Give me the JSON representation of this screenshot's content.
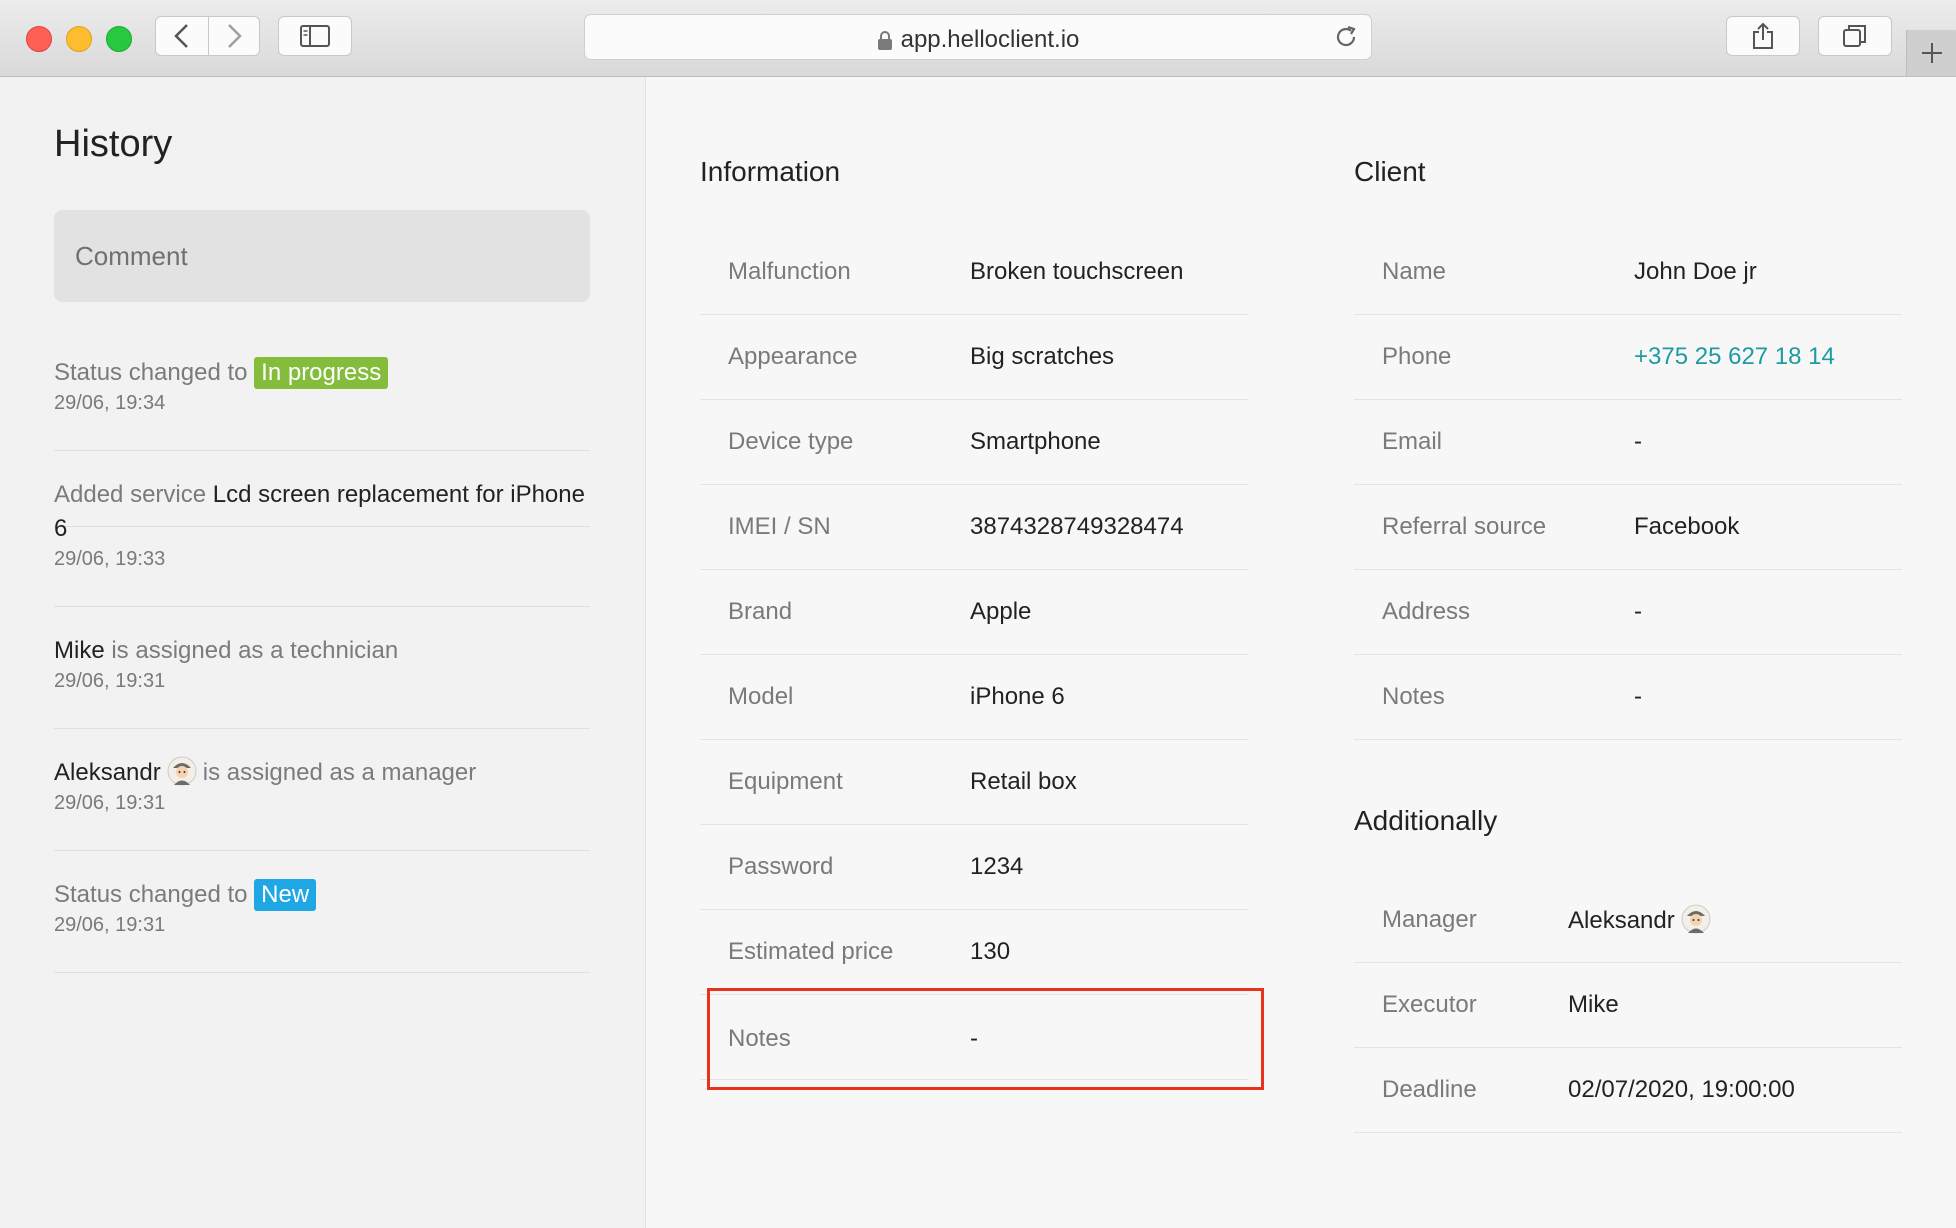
{
  "browser": {
    "url": "app.helloclient.io"
  },
  "sidebar": {
    "title": "History",
    "comment_placeholder": "Comment",
    "history": [
      {
        "pre": "Status changed to",
        "badge": "In progress",
        "time": "29/06, 19:34"
      },
      {
        "pre": "Added service",
        "strong": "Lcd screen replacement for iPhone 6",
        "time": "29/06, 19:33"
      },
      {
        "strong": "Mike",
        "post": "is assigned as a technician",
        "time": "29/06, 19:31"
      },
      {
        "strong": "Aleksandr",
        "post": "is assigned as a manager",
        "time": "29/06, 19:31"
      },
      {
        "pre": "Status changed to",
        "badge": "New",
        "time": "29/06, 19:31"
      }
    ]
  },
  "information": {
    "title": "Information",
    "rows": [
      {
        "label": "Malfunction",
        "value": "Broken touchscreen"
      },
      {
        "label": "Appearance",
        "value": "Big scratches"
      },
      {
        "label": "Device type",
        "value": "Smartphone"
      },
      {
        "label": "IMEI / SN",
        "value": "3874328749328474"
      },
      {
        "label": "Brand",
        "value": "Apple"
      },
      {
        "label": "Model",
        "value": "iPhone 6"
      },
      {
        "label": "Equipment",
        "value": "Retail box"
      },
      {
        "label": "Password",
        "value": "1234"
      },
      {
        "label": "Estimated price",
        "value": "130"
      },
      {
        "label": "Notes",
        "value": "-"
      }
    ]
  },
  "client": {
    "title": "Client",
    "rows": [
      {
        "label": "Name",
        "value": "John Doe jr"
      },
      {
        "label": "Phone",
        "value": "+375 25 627 18 14"
      },
      {
        "label": "Email",
        "value": "-"
      },
      {
        "label": "Referral source",
        "value": "Facebook"
      },
      {
        "label": "Address",
        "value": "-"
      },
      {
        "label": "Notes",
        "value": "-"
      }
    ]
  },
  "additionally": {
    "title": "Additionally",
    "rows": [
      {
        "label": "Manager",
        "value": "Aleksandr"
      },
      {
        "label": "Executor",
        "value": "Mike"
      },
      {
        "label": "Deadline",
        "value": "02/07/2020, 19:00:00"
      }
    ]
  },
  "colors": {
    "in_progress_badge": "#84bd3c",
    "new_badge": "#1fa7e5",
    "phone_link": "#1e9aa3",
    "highlight_box": "#e8321e"
  },
  "icons": [
    "back-icon",
    "forward-icon",
    "sidebar-toggle-icon",
    "lock-icon",
    "reload-icon",
    "share-icon",
    "tabs-icon",
    "new-tab-icon",
    "avatar-icon"
  ]
}
